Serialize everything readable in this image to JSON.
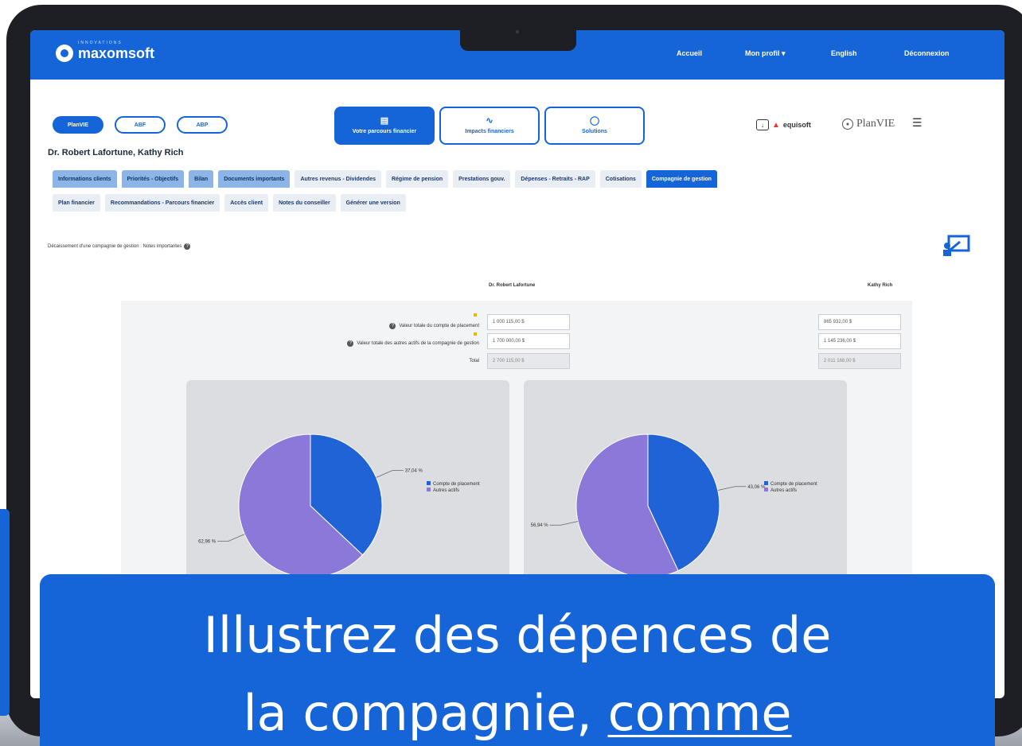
{
  "header": {
    "brand": "maxomsoft",
    "brand_sub": "INNOVATIONS",
    "nav": [
      "Accueil",
      "Mon profil ▾",
      "English",
      "Déconnexion"
    ]
  },
  "clients": {
    "pills": [
      "PlanVIE",
      "ABF",
      "ABP"
    ],
    "name": "Dr. Robert Lafortune, Kathy Rich"
  },
  "big_tabs": [
    {
      "label": "Votre parcours financier",
      "icon": "chart-icon"
    },
    {
      "label": "Impacts financiers",
      "icon": "trend-icon"
    },
    {
      "label": "Solutions",
      "icon": "lightbulb-icon"
    }
  ],
  "partners": {
    "equisoft": "equisoft",
    "planvie": "PlanVIE"
  },
  "tabs_row1": [
    {
      "label": "Informations clients",
      "state": "done"
    },
    {
      "label": "Priorités - Objectifs",
      "state": "done"
    },
    {
      "label": "Bilan",
      "state": "done"
    },
    {
      "label": "Documents importants",
      "state": "done"
    },
    {
      "label": "Autres revenus - Dividendes",
      "state": "default"
    },
    {
      "label": "Régime de pension",
      "state": "default"
    },
    {
      "label": "Prestations gouv.",
      "state": "default"
    },
    {
      "label": "Dépenses - Retraits - RAP",
      "state": "default"
    },
    {
      "label": "Cotisations",
      "state": "default"
    },
    {
      "label": "Compagnie de gestion",
      "state": "active"
    }
  ],
  "tabs_row2": [
    {
      "label": "Plan financier"
    },
    {
      "label": "Recommandations - Parcours financier"
    },
    {
      "label": "Accès client"
    },
    {
      "label": "Notes du conseiller"
    },
    {
      "label": "Générer une version"
    }
  ],
  "section": {
    "label": "Décaissement d'une compagnie de gestion : Notes importantes"
  },
  "columns": {
    "left": "Dr. Robert Lafortune",
    "right": "Kathy Rich"
  },
  "form": {
    "row1_label": "Valeur totale du compte de placement",
    "row2_label": "Valeur totale des autres actifs de la compagnie de gestion",
    "total_label": "Total",
    "left": {
      "row1": "1 000 115,00 $",
      "row2": "1 700 000,00 $",
      "total": "2 700 115,00 $"
    },
    "right": {
      "row1": "865 932,00 $",
      "row2": "1 145 236,00 $",
      "total": "2 011 168,00 $"
    }
  },
  "chart_data": [
    {
      "type": "pie",
      "series": [
        {
          "name": "Compte de placement",
          "value": 37.04
        },
        {
          "name": "Autres actifs",
          "value": 62.96
        }
      ],
      "labels": [
        "37,04 %",
        "62,96 %"
      ],
      "legend": "right",
      "colors": [
        "#1f63d6",
        "#8b78d8"
      ]
    },
    {
      "type": "pie",
      "series": [
        {
          "name": "Compte de placement",
          "value": 43.06
        },
        {
          "name": "Autres actifs",
          "value": 56.94
        }
      ],
      "labels": [
        "43,06 %",
        "56,94 %"
      ],
      "legend": "right",
      "colors": [
        "#1f63d6",
        "#8b78d8"
      ]
    }
  ],
  "banner": {
    "line1": "Illustrez des dépences de",
    "line2_plain": "la compagnie, ",
    "line2_underlined": "comme"
  },
  "colors": {
    "primary": "#1565d8",
    "tab_done": "#8db4e6",
    "pie_blue": "#1f63d6",
    "pie_purple": "#8b78d8"
  }
}
